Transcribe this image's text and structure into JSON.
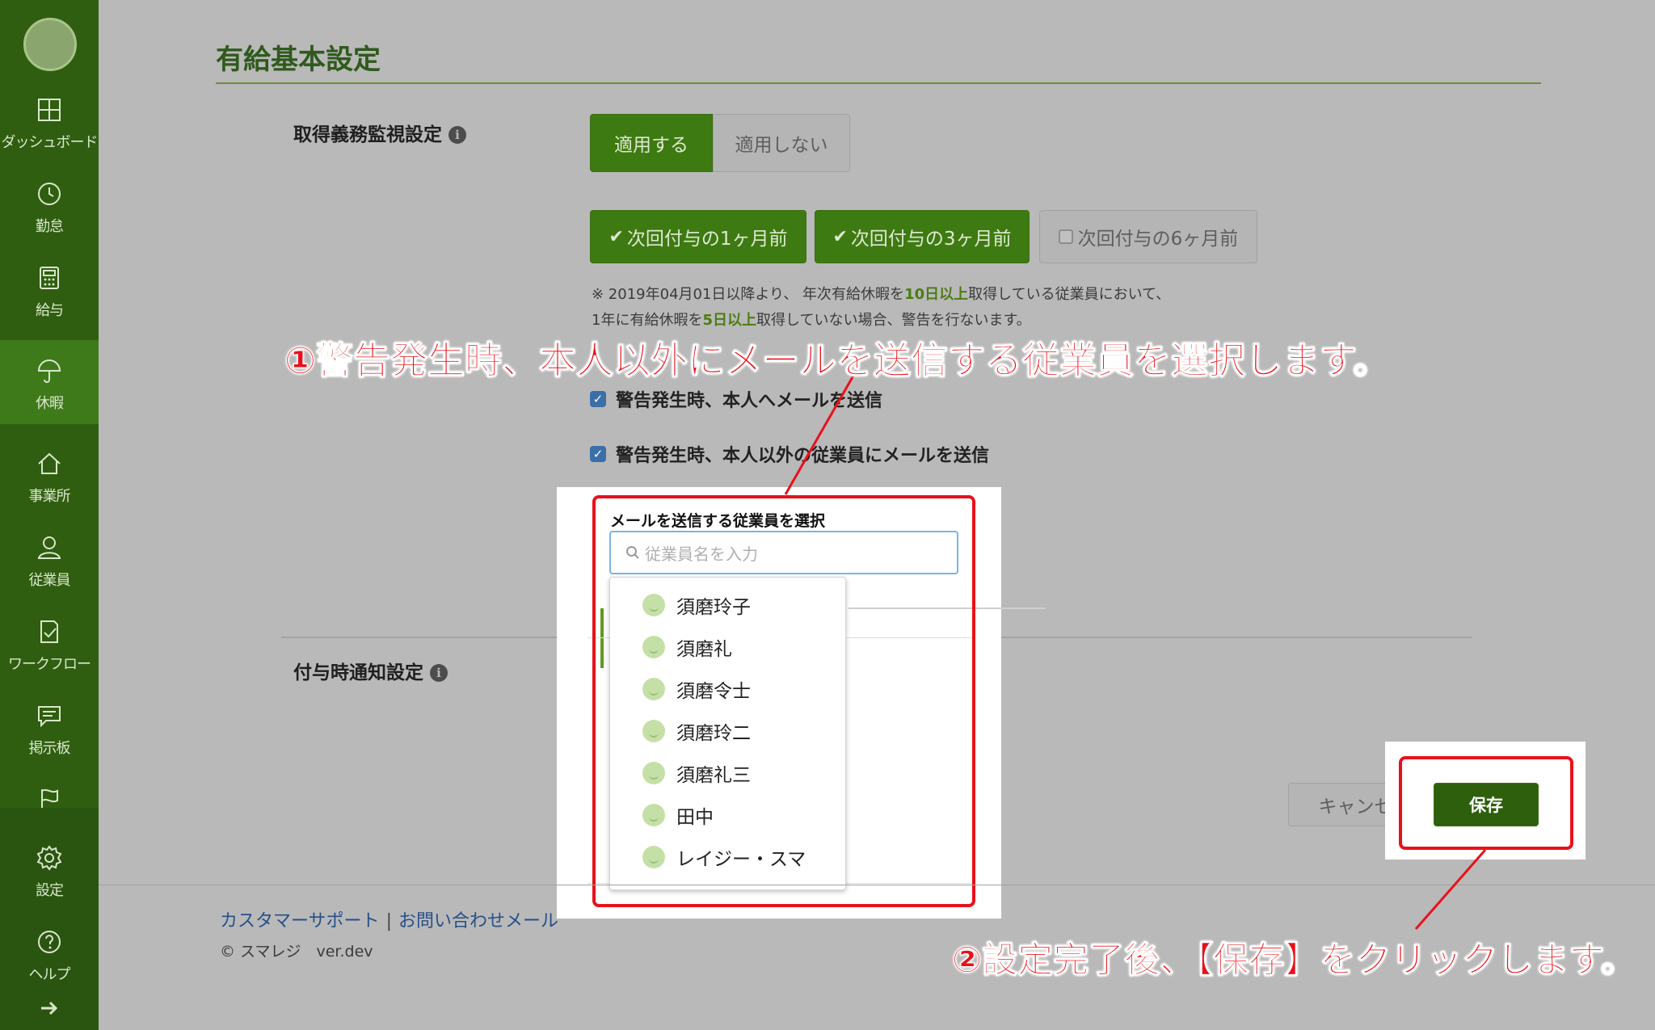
{
  "sidebar": {
    "items": [
      {
        "label": "ダッシュボード",
        "icon": "dashboard-icon"
      },
      {
        "label": "勤怠",
        "icon": "clock-icon"
      },
      {
        "label": "給与",
        "icon": "calculator-icon"
      },
      {
        "label": "休暇",
        "icon": "umbrella-icon"
      },
      {
        "label": "事業所",
        "icon": "home-icon"
      },
      {
        "label": "従業員",
        "icon": "user-icon"
      },
      {
        "label": "ワークフロー",
        "icon": "workflow-icon"
      },
      {
        "label": "掲示板",
        "icon": "chat-icon"
      },
      {
        "label": "",
        "icon": "flag-icon"
      },
      {
        "label": "設定",
        "icon": "gear-icon"
      },
      {
        "label": "ヘルプ",
        "icon": "help-icon"
      }
    ],
    "active_index": 3
  },
  "page": {
    "title": "有給基本設定"
  },
  "obligation": {
    "label": "取得義務監視設定",
    "apply_label": "適用する",
    "not_apply_label": "適用しない",
    "timing_options": [
      {
        "label": "次回付与の1ヶ月前",
        "checked": true
      },
      {
        "label": "次回付与の3ヶ月前",
        "checked": true
      },
      {
        "label": "次回付与の6ヶ月前",
        "checked": false
      }
    ],
    "note_line1_a": "※ 2019年04月01日以降より、 年次有給休暇を",
    "note_line1_b": "10日以上",
    "note_line1_c": "取得している従業員において、",
    "note_line2_a": "1年に有給休暇を",
    "note_line2_b": "5日以上",
    "note_line2_c": "取得していない場合、警告を行ないます。",
    "cb_self": "警告発生時、本人へメールを送信",
    "cb_others": "警告発生時、本人以外の従業員にメールを送信"
  },
  "employee_select": {
    "label": "メールを送信する従業員を選択",
    "placeholder": "従業員名を入力",
    "options": [
      "須磨玲子",
      "須磨礼",
      "須磨令士",
      "須磨玲二",
      "須磨礼三",
      "田中",
      "レイジー・スマ"
    ]
  },
  "grant_notice": {
    "label": "付与時通知設定"
  },
  "actions": {
    "cancel_label": "キャンセル",
    "save_label": "保存"
  },
  "footer": {
    "support_link": "カスタマーサポート",
    "separator": "|",
    "contact_link": "お問い合わせメール",
    "copyright": "© スマレジ　ver.dev"
  },
  "annotations": {
    "step1": "①警告発生時、本人以外にメールを送信する従業員を選択します。",
    "step2": "②設定完了後、【保存】をクリックします。"
  },
  "colors": {
    "accent_green": "#3e7a12",
    "annotation_red": "#e8111b",
    "sidebar_green": "#2f5e10"
  }
}
